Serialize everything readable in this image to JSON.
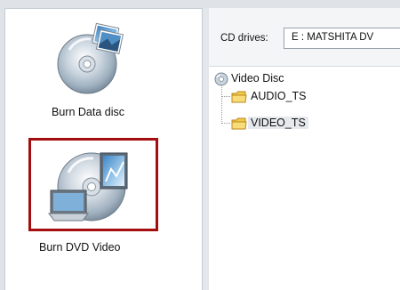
{
  "actions": {
    "burn_data_disc": {
      "label": "Burn Data disc"
    },
    "burn_dvd_video": {
      "label": "Burn DVD Video"
    }
  },
  "toolbar": {
    "cd_drives_label": "CD drives:",
    "cd_drive_value": "E : MATSHITA DV"
  },
  "tree": {
    "root": {
      "label": "Video Disc",
      "icon": "disc-icon"
    },
    "children": [
      {
        "label": "AUDIO_TS",
        "icon": "folder-icon",
        "selected": false
      },
      {
        "label": "VIDEO_TS",
        "icon": "folder-icon",
        "selected": true
      }
    ]
  },
  "colors": {
    "selection_border": "#a40e0e",
    "folder_yellow": "#f2c94c"
  }
}
